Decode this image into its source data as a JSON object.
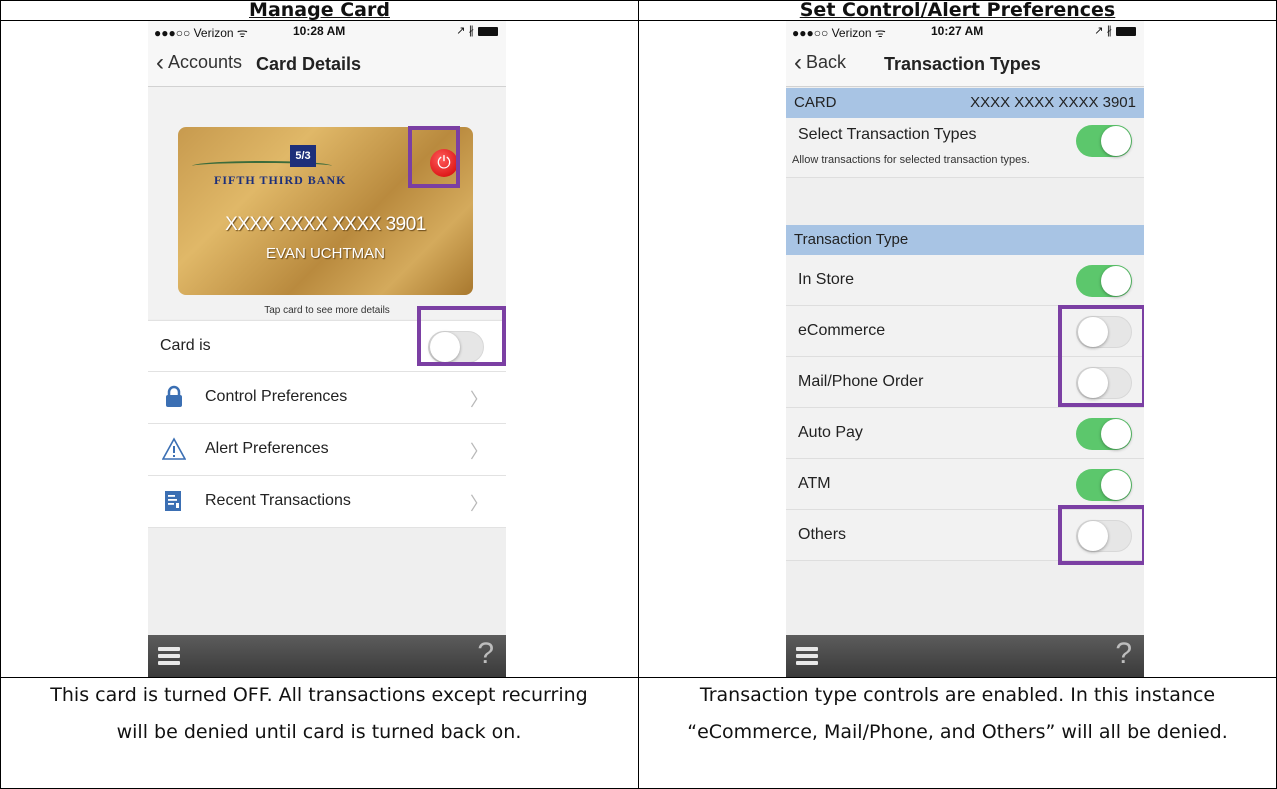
{
  "columns": {
    "left_title": "Manage Card",
    "right_title": "Set Control/Alert Preferences",
    "left_caption": "This card is turned OFF. All transactions except recurring will be denied until card is turned back on.",
    "right_caption": "Transaction type controls are enabled. In this instance “eCommerce, Mail/Phone, and Others” will all be denied."
  },
  "left_phone": {
    "status": {
      "carrier": "●●●○○ Verizon ᯤ",
      "time": "10:28 AM",
      "right": "↗ ∦"
    },
    "nav": {
      "back_label": "Accounts",
      "title": "Card Details"
    },
    "card": {
      "bank_logo": "5/3",
      "bank_name": "FIFTH THIRD BANK",
      "number": "XXXX XXXX XXXX 3901",
      "holder": "EVAN UCHTMAN",
      "hint": "Tap card to see more details"
    },
    "card_status": {
      "label": "Card is",
      "enabled": false
    },
    "menu": [
      {
        "label": "Control Preferences",
        "icon": "lock-icon"
      },
      {
        "label": "Alert Preferences",
        "icon": "warning-icon"
      },
      {
        "label": "Recent Transactions",
        "icon": "document-icon"
      }
    ]
  },
  "right_phone": {
    "status": {
      "carrier": "●●●○○ Verizon ᯤ",
      "time": "10:27 AM",
      "right": "↗ ∦"
    },
    "nav": {
      "back_label": "Back",
      "title": "Transaction Types"
    },
    "card_header": {
      "label": "CARD",
      "number": "XXXX XXXX XXXX 3901"
    },
    "select_types": {
      "label": "Select Transaction Types",
      "note": "Allow transactions for selected transaction types.",
      "enabled": true
    },
    "section_label": "Transaction Type",
    "types": [
      {
        "label": "In Store",
        "enabled": true
      },
      {
        "label": "eCommerce",
        "enabled": false
      },
      {
        "label": "Mail/Phone Order",
        "enabled": false
      },
      {
        "label": "Auto Pay",
        "enabled": true
      },
      {
        "label": "ATM",
        "enabled": true
      },
      {
        "label": "Others",
        "enabled": false
      }
    ]
  },
  "colors": {
    "toggle_on": "#5cc76c",
    "highlight": "#7b3fa3",
    "section_blue": "#a8c4e4"
  }
}
